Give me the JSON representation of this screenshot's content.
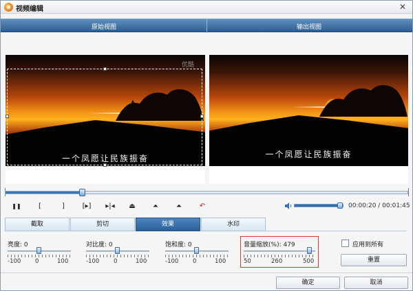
{
  "window": {
    "title": "视频编辑",
    "close_glyph": "✕"
  },
  "views": {
    "original_label": "原始视图",
    "output_label": "输出视图"
  },
  "preview": {
    "caption": "一个凤愿让民族振奋",
    "watermark_text": "优酷"
  },
  "playback": {
    "timecode": "00:00:20 / 00:01:45",
    "progress_fraction": 0.19,
    "volume_fraction": 1.0,
    "controls": [
      {
        "name": "pause-button",
        "glyph": "❚❚"
      },
      {
        "name": "mark-in-button",
        "glyph": "["
      },
      {
        "name": "mark-out-button",
        "glyph": "]"
      },
      {
        "name": "play-selection-button",
        "glyph": "[▸]"
      },
      {
        "name": "step-button",
        "glyph": "▸|◂"
      },
      {
        "name": "seek-in-button",
        "glyph": "⏏"
      },
      {
        "name": "seek-out-button",
        "glyph": "⏶"
      },
      {
        "name": "jump-button",
        "glyph": "⏶"
      },
      {
        "name": "undo-button",
        "glyph": "↶"
      }
    ]
  },
  "tabs": [
    {
      "label": "截取",
      "active": false
    },
    {
      "label": "剪切",
      "active": false
    },
    {
      "label": "效果",
      "active": true
    },
    {
      "label": "水印",
      "active": false
    }
  ],
  "adjustments": [
    {
      "label": "亮度: 0",
      "value": 0,
      "min": "-100",
      "mid": "0",
      "max": "100"
    },
    {
      "label": "对比度: 0",
      "value": 0,
      "min": "-100",
      "mid": "0",
      "max": "100"
    },
    {
      "label": "饱和度: 0",
      "value": 0,
      "min": "-100",
      "mid": "0",
      "max": "100"
    }
  ],
  "volume_scale": {
    "label": "音量缩放(%): 479",
    "value": 479,
    "min": "50",
    "mid": "260",
    "max": "500"
  },
  "apply_all": {
    "label": "应用到所有",
    "checked": false
  },
  "buttons": {
    "reset": "重置",
    "ok": "确定",
    "cancel": "取消"
  },
  "colors": {
    "accent": "#2d5f97",
    "highlight_border": "#d43a3a"
  }
}
